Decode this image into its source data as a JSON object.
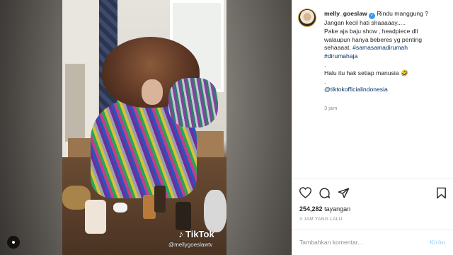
{
  "post": {
    "username": "melly_goeslaw",
    "caption_lines": [
      "Rindu manggung ?",
      "Jangan kecil hati shaaaaay.....",
      "Pake aja baju show , headpiece dll",
      "walaupun hanya beberes yg penting",
      "sehaaaat."
    ],
    "hashtags": [
      "#samasamadirumah",
      "#dirumahaja"
    ],
    "dot1": ".",
    "line_after": "Halu itu hak setiap manusia",
    "emoji": "🤣",
    "dot2": ".",
    "mention": "@tiktokofficialindonesia",
    "relative_time": "3 jam",
    "views_count": "254,282",
    "views_label": "tayangan",
    "posted_time": "3 JAM YANG LALU",
    "comment_placeholder": "Tambahkan komentar...",
    "send_label": "Kirim"
  },
  "video": {
    "tiktok_brand": "TikTok",
    "tiktok_handle": "@mellygoeslawtv"
  },
  "icons": {
    "verified": "verified-badge-icon",
    "like": "heart-icon",
    "comment": "comment-icon",
    "share": "paper-plane-icon",
    "save": "bookmark-icon",
    "audio": "audio-icon"
  },
  "colors": {
    "link": "#003569",
    "verified": "#3897f0",
    "muted": "#8e8e8e",
    "send": "#b3dbff"
  }
}
